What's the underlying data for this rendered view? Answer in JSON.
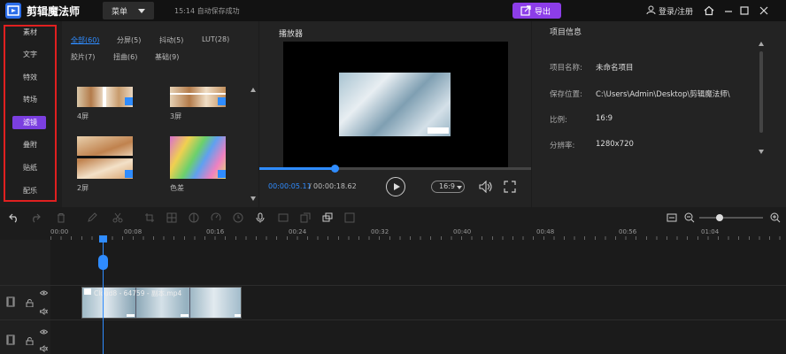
{
  "app": {
    "name": "剪辑魔法师",
    "menu": "菜单",
    "save_status": "15:14 自动保存成功",
    "export": "导出",
    "login": "登录/注册"
  },
  "categories": [
    "素材",
    "文字",
    "特效",
    "转场",
    "滤镜",
    "叠附",
    "贴纸",
    "配乐"
  ],
  "active_category": "滤镜",
  "media": {
    "tabs_row1": [
      "全部(60)",
      "分屏(5)",
      "抖动(5)",
      "LUT(28)"
    ],
    "tabs_row2": [
      "胶片(7)",
      "扭曲(6)",
      "基础(9)"
    ],
    "active_tab": "全部(60)",
    "items": [
      "4屏",
      "3屏",
      "2屏",
      "色差"
    ]
  },
  "player": {
    "title": "播放器",
    "current_time": "00:00:05.11",
    "total_time": "00:00:18.62",
    "ratio": "16:9",
    "progress": 0.28
  },
  "info": {
    "title": "项目信息",
    "rows": [
      {
        "label": "项目名称:",
        "value": "未命名项目"
      },
      {
        "label": "保存位置:",
        "value": "C:\\Users\\Admin\\Desktop\\剪辑魔法师\\"
      },
      {
        "label": "比例:",
        "value": "16:9"
      },
      {
        "label": "分辨率:",
        "value": "1280x720"
      }
    ]
  },
  "timeline": {
    "ticks": [
      "00:00",
      "00:08",
      "00:16",
      "00:24",
      "00:32",
      "00:40",
      "00:48",
      "00:56",
      "01:04"
    ],
    "clip_label": "Cloud8 - 64759 - 副本.mp4"
  },
  "colors": {
    "accent": "#2f8cff",
    "export": "#8c3de8",
    "highlight_box": "#e02020"
  }
}
